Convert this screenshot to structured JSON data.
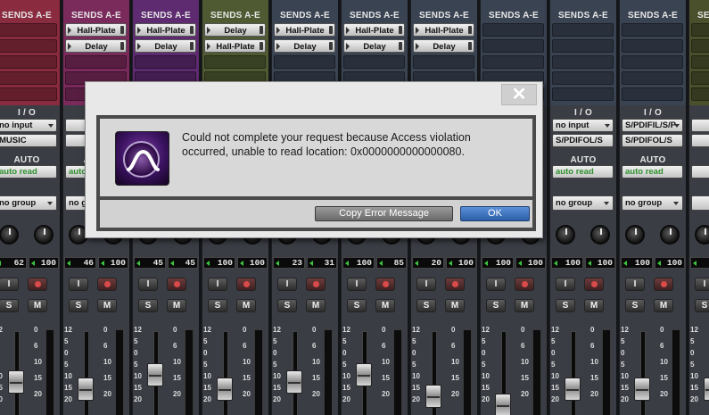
{
  "mixer": {
    "sends_header": "SENDS A-E",
    "io_header": "I / O",
    "auto_header": "AUTO",
    "strips": [
      {
        "color": "#8b2b3f",
        "sends": [],
        "io": [
          "no input",
          "MUSIC"
        ],
        "auto": "auto read",
        "group": "no group",
        "pan": [
          "62",
          "100"
        ],
        "buttons": [
          "I",
          "S",
          "M"
        ]
      },
      {
        "color": "#7b2a5c",
        "sends": [
          "Hall-Plate",
          "Delay"
        ],
        "io": [
          "",
          ""
        ],
        "auto": "auto read",
        "group": "no group",
        "pan": [
          "46",
          "100"
        ],
        "buttons": [
          "I",
          "S",
          "M"
        ]
      },
      {
        "color": "#5e2a70",
        "sends": [
          "Hall-Plate",
          "Delay"
        ],
        "io": [
          "",
          ""
        ],
        "auto": "",
        "group": "",
        "pan": [
          "45",
          "45"
        ],
        "buttons": [
          "I",
          "S",
          "M"
        ]
      },
      {
        "color": "#4f5a33",
        "sends": [
          "Delay",
          "Hall-Plate"
        ],
        "io": [
          "",
          ""
        ],
        "auto": "",
        "group": "",
        "pan": [
          "100",
          "100"
        ],
        "buttons": [
          "I",
          "S",
          "M"
        ]
      },
      {
        "color": "#3a4352",
        "sends": [
          "Hall-Plate",
          "Delay"
        ],
        "io": [
          "",
          ""
        ],
        "auto": "",
        "group": "",
        "pan": [
          "23",
          "31"
        ],
        "buttons": [
          "I",
          "S",
          "M"
        ]
      },
      {
        "color": "#3a4352",
        "sends": [
          "Hall-Plate",
          "Delay"
        ],
        "io": [
          "",
          ""
        ],
        "auto": "",
        "group": "",
        "pan": [
          "100",
          "85"
        ],
        "buttons": [
          "I",
          "S",
          "M"
        ]
      },
      {
        "color": "#3a4352",
        "sends": [
          "Hall-Plate",
          "Delay"
        ],
        "io": [
          "",
          ""
        ],
        "auto": "",
        "group": "",
        "pan": [
          "20",
          "100"
        ],
        "buttons": [
          "I",
          "S",
          "M"
        ]
      },
      {
        "color": "#3a4352",
        "sends": [],
        "io": [
          "",
          ""
        ],
        "auto": "",
        "group": "",
        "pan": [
          "100",
          "100"
        ],
        "buttons": [
          "I",
          "S",
          "M"
        ]
      },
      {
        "color": "#3a4352",
        "sends": [],
        "io": [
          "no input",
          "S/PDIFOL/S"
        ],
        "auto": "auto read",
        "group": "no group",
        "pan": [
          "100",
          "100"
        ],
        "buttons": [
          "I",
          "S",
          "M"
        ]
      },
      {
        "color": "#3a4352",
        "sends": [],
        "io": [
          "S/PDIFIL/S/P",
          "S/PDIFOL/S"
        ],
        "auto": "auto read",
        "group": "no group",
        "pan": [
          "100",
          "100"
        ],
        "buttons": [
          "I",
          "S",
          "M"
        ]
      },
      {
        "color": "#4a4f2c",
        "sends": [],
        "io": [
          "",
          ""
        ],
        "auto": "",
        "group": "",
        "pan": [
          "",
          ""
        ],
        "buttons": [
          "I",
          "S",
          "M"
        ]
      }
    ],
    "fader_scale": [
      "12",
      "5",
      "0",
      "5",
      "10",
      "15",
      "20"
    ],
    "meter_scale": [
      "0",
      "6",
      "10",
      "15",
      "20"
    ]
  },
  "dialog": {
    "message_line1": "Could not complete your request because Access violation",
    "message_line2": "occurred, unable to read location: 0x0000000000000080.",
    "copy_button": "Copy Error Message",
    "ok_button": "OK",
    "close_glyph": "✕",
    "logo_icon": "pro-tools-logo-icon"
  }
}
